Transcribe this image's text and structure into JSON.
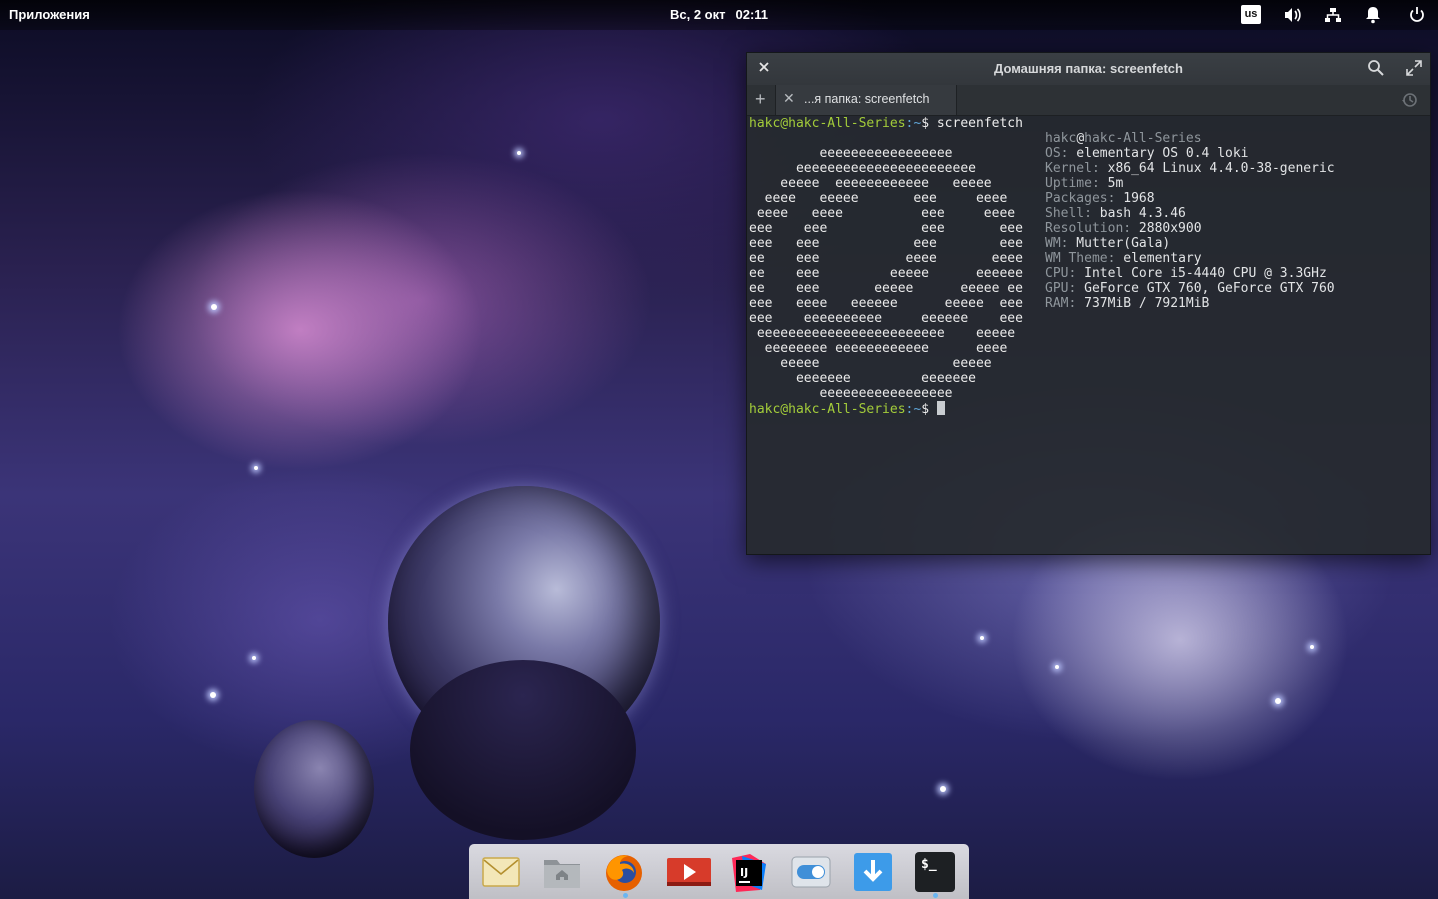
{
  "panel": {
    "applications_label": "Приложения",
    "date": "Вс, 2 окт",
    "time": "02:11",
    "keyboard_layout": "us"
  },
  "terminal": {
    "title": "Домашняя папка: screenfetch",
    "tab_label": "...я папка: screenfetch",
    "prompt_user": "hakc@hakc-All-Series",
    "prompt_path": ":~",
    "prompt_symbol": "$",
    "command": " screenfetch",
    "logo": "         eeeeeeeeeeeeeeeee\n      eeeeeeeeeeeeeeeeeeeeeee\n    eeeee  eeeeeeeeeeee   eeeee\n  eeee   eeeee       eee     eeee\n eeee   eeee          eee     eeee\neee    eee            eee       eee\neee   eee            eee        eee\nee    eee           eeee       eeee\nee    eee         eeeee      eeeeee\nee    eee       eeeee      eeeee ee\neee   eeee   eeeeee      eeeee  eee\neee    eeeeeeeeee     eeeeee    eee\n eeeeeeeeeeeeeeeeeeeeeeee    eeeee\n  eeeeeeee eeeeeeeeeeee      eeee\n    eeeee                 eeeee\n      eeeeeee         eeeeeee\n         eeeeeeeeeeeeeeeee",
    "info_header_user": "hakc",
    "info_header_at": "@",
    "info_header_host": "hakc-All-Series",
    "info": [
      {
        "key": "OS:",
        "value": " elementary OS 0.4 loki"
      },
      {
        "key": "Kernel:",
        "value": " x86_64 Linux 4.4.0-38-generic"
      },
      {
        "key": "Uptime:",
        "value": " 5m"
      },
      {
        "key": "Packages:",
        "value": " 1968"
      },
      {
        "key": "Shell:",
        "value": " bash 4.3.46"
      },
      {
        "key": "Resolution:",
        "value": " 2880x900"
      },
      {
        "key": "WM:",
        "value": " Mutter(Gala)"
      },
      {
        "key": "WM Theme:",
        "value": " elementary"
      },
      {
        "key": "CPU:",
        "value": " Intel Core i5-4440 CPU @ 3.3GHz"
      },
      {
        "key": "GPU:",
        "value": " GeForce GTX 760, GeForce GTX 760"
      },
      {
        "key": "RAM:",
        "value": " 737MiB / 7921MiB"
      }
    ]
  },
  "dock": {
    "items": [
      "mail-icon",
      "files-icon",
      "firefox-icon",
      "videos-icon",
      "intellij-icon",
      "switchboard-icon",
      "appcenter-download-icon",
      "terminal-icon"
    ],
    "terminal_glyph": "$_",
    "intellij_glyph": "IJ"
  },
  "colors": {
    "prompt_user": "#a3cc3a",
    "prompt_path": "#5fa6d8",
    "info_key": "#8f969c",
    "dock_running_indicator": "#6ab6f2"
  }
}
